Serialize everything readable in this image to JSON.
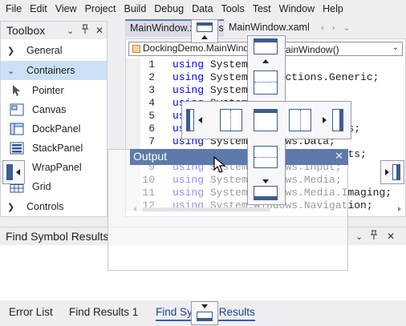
{
  "menu": [
    "File",
    "Edit",
    "View",
    "Project",
    "Build",
    "Debug",
    "Data",
    "Tools",
    "Test",
    "Window",
    "Help"
  ],
  "toolbox": {
    "title": "Toolbox",
    "groups": [
      {
        "label": "General",
        "expanded": false
      },
      {
        "label": "Containers",
        "expanded": true
      },
      {
        "label": "Controls",
        "expanded": false
      }
    ],
    "items": [
      "Pointer",
      "Canvas",
      "DockPanel",
      "StackPanel",
      "WrapPanel",
      "Grid"
    ]
  },
  "document": {
    "tabs": [
      "MainWindow.xaml.cs",
      "MainWindow.xaml"
    ],
    "nav_class": "DockingDemo.MainWindow",
    "nav_member": "MainWindow()",
    "keyword": "using",
    "lines": [
      {
        "n": "1",
        "ns": "System;"
      },
      {
        "n": "2",
        "ns": "System.Collections.Generic;"
      },
      {
        "n": "3",
        "ns": "System.Linq;"
      },
      {
        "n": "4",
        "ns": "System.Text;"
      },
      {
        "n": "5",
        "ns": "System.Windows;"
      },
      {
        "n": "6",
        "ns": "System.Windows.Controls;"
      },
      {
        "n": "7",
        "ns": "System.Windows.Data;"
      },
      {
        "n": "8",
        "ns": "System.Windows.Documents;"
      },
      {
        "n": "9",
        "ns": "System.Windows.Input;"
      },
      {
        "n": "10",
        "ns": "System.Windows.Media;"
      },
      {
        "n": "11",
        "ns": "System.Windows.Media.Imaging;"
      },
      {
        "n": "12",
        "ns": "System.Windows.Navigation;"
      }
    ]
  },
  "output_window": {
    "title": "Output",
    "close": "✕"
  },
  "find_panel": {
    "title": "Find Symbol Results"
  },
  "bottom_tabs": [
    "Error List",
    "Find Results 1",
    "Find Symbol Results"
  ],
  "colors": {
    "accent": "#5e79ac",
    "keyword": "#0000ff",
    "selection": "#cce0f5"
  }
}
